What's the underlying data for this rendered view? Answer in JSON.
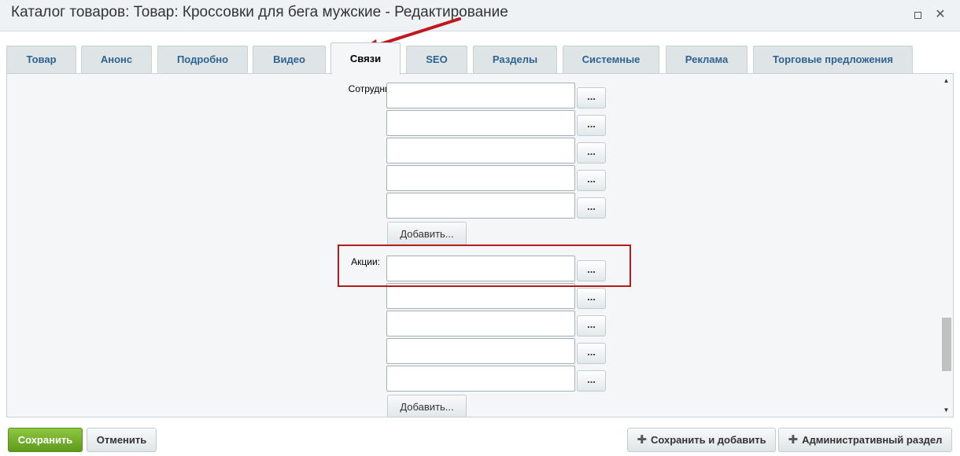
{
  "window": {
    "title": "Каталог товаров: Товар: Кроссовки для бега мужские - Редактирование",
    "maximize_icon": "maximize-icon",
    "close_glyph": "✕"
  },
  "tabs": [
    {
      "label": "Товар",
      "active": false
    },
    {
      "label": "Анонс",
      "active": false
    },
    {
      "label": "Подробно",
      "active": false
    },
    {
      "label": "Видео",
      "active": false
    },
    {
      "label": "Связи",
      "active": true
    },
    {
      "label": "SEO",
      "active": false
    },
    {
      "label": "Разделы",
      "active": false
    },
    {
      "label": "Системные",
      "active": false
    },
    {
      "label": "Реклама",
      "active": false
    },
    {
      "label": "Торговые предложения",
      "active": false
    }
  ],
  "employees": {
    "label": "Сотрудники:",
    "fields": [
      "",
      "",
      "",
      "",
      ""
    ],
    "browse_label": "...",
    "add_label": "Добавить..."
  },
  "promotions": {
    "label": "Акции:",
    "fields": [
      "",
      "",
      "",
      "",
      ""
    ],
    "browse_label": "...",
    "add_label": "Добавить..."
  },
  "footer": {
    "save_label": "Сохранить",
    "cancel_label": "Отменить",
    "save_and_add_label": "Сохранить и добавить",
    "admin_section_label": "Административный раздел",
    "plus_glyph": "✚"
  },
  "colors": {
    "accent_green": "#6aa925",
    "tab_text": "#2d6392",
    "highlight": "#b31b1b",
    "annotation_arrow": "#c0161c"
  }
}
